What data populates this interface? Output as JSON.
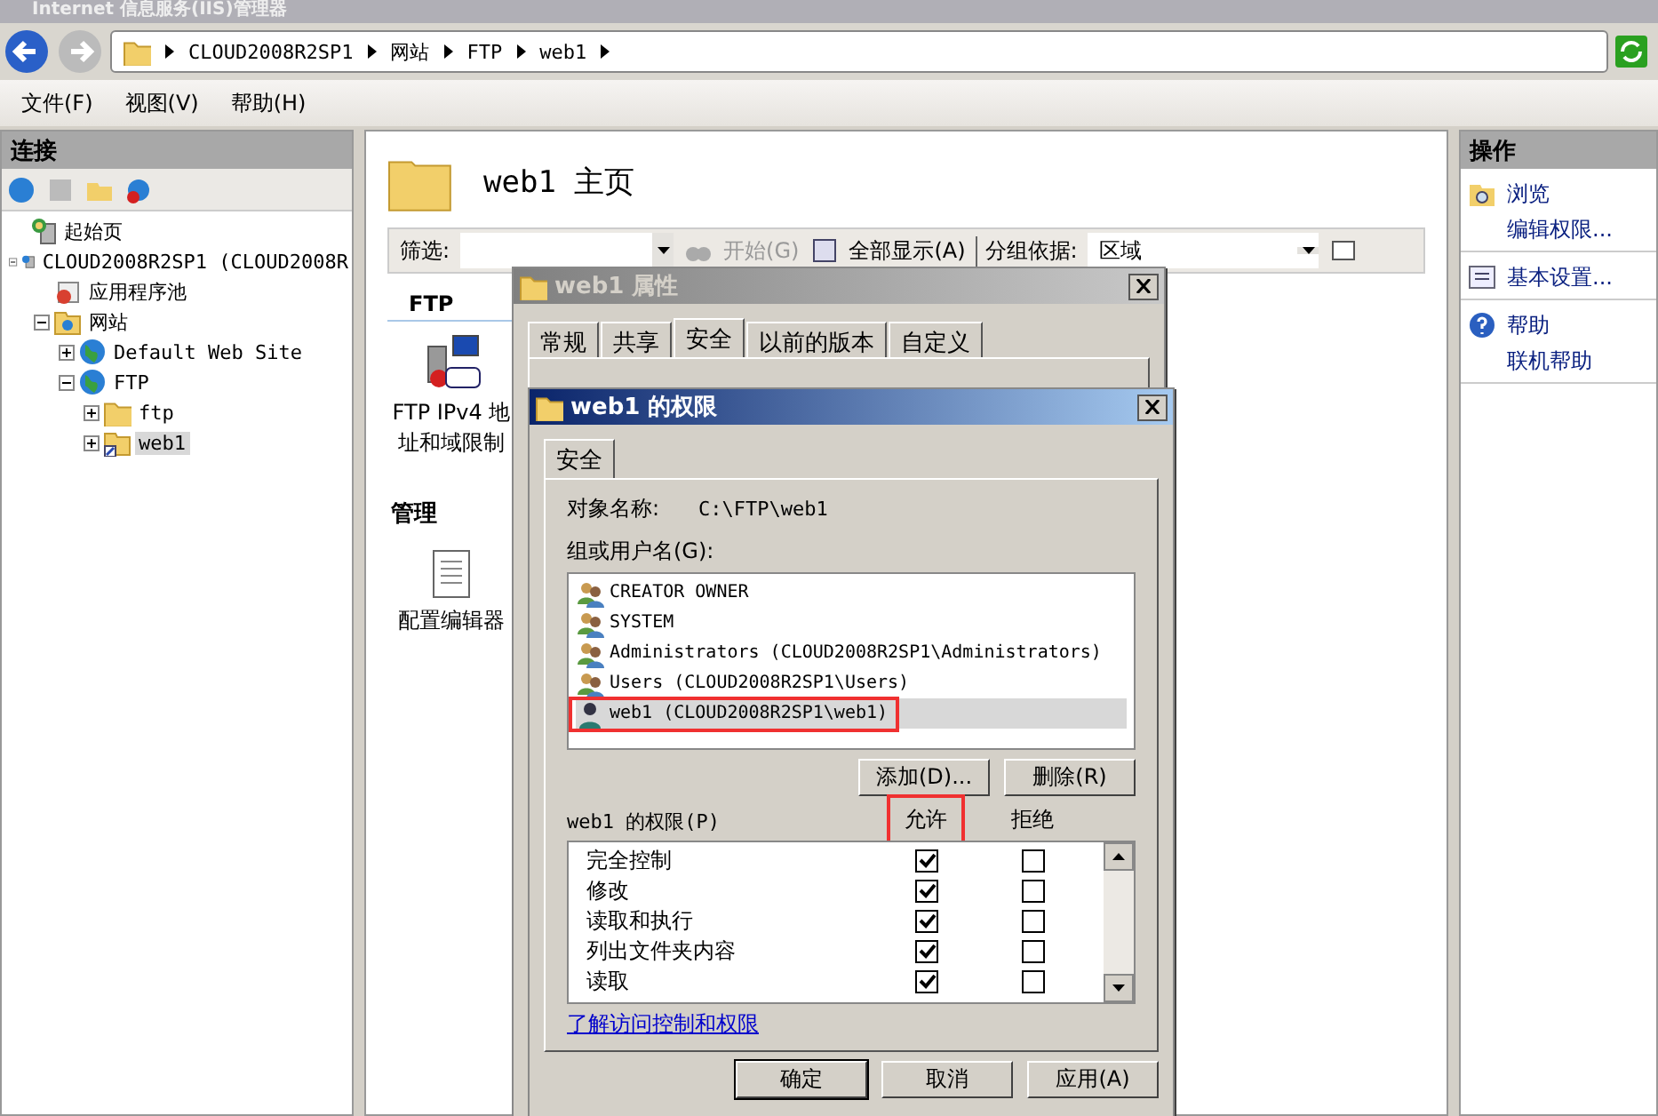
{
  "window": {
    "title": "Internet 信息服务(IIS)管理器"
  },
  "breadcrumb": [
    "CLOUD2008R2SP1",
    "网站",
    "FTP",
    "web1"
  ],
  "menu": [
    "文件(F)",
    "视图(V)",
    "帮助(H)"
  ],
  "connections": {
    "title": "连接",
    "tree": [
      {
        "label": "起始页",
        "kind": "start"
      },
      {
        "label": "CLOUD2008R2SP1 (CLOUD2008R",
        "kind": "server",
        "expanded": true,
        "children": [
          {
            "label": "应用程序池",
            "kind": "pool"
          },
          {
            "label": "网站",
            "kind": "sites",
            "expanded": true,
            "children": [
              {
                "label": "Default Web Site",
                "kind": "site",
                "expanded": false
              },
              {
                "label": "FTP",
                "kind": "site",
                "expanded": true,
                "children": [
                  {
                    "label": "ftp",
                    "kind": "folder",
                    "expanded": false,
                    "selected": false
                  },
                  {
                    "label": "web1",
                    "kind": "vdir",
                    "expanded": false,
                    "selected": true
                  }
                ]
              }
            ]
          }
        ]
      }
    ]
  },
  "content": {
    "title": "web1 主页",
    "filter": {
      "label": "筛选:",
      "go": {
        "label": "开始(G)",
        "disabled": true
      },
      "show_all": "全部显示(A)",
      "group_label": "分组依据:",
      "group_value": "区域"
    },
    "sections": [
      {
        "title": "FTP",
        "items": [
          {
            "label": "FTP IPv4 地址和域限制",
            "kind": "ftp"
          }
        ]
      },
      {
        "title": "管理",
        "items": [
          {
            "label": "配置编辑器",
            "kind": "config"
          }
        ]
      }
    ]
  },
  "actions": {
    "title": "操作",
    "groups": [
      {
        "items": [
          {
            "label": "浏览",
            "kind": "browse"
          },
          {
            "label": "编辑权限..."
          }
        ]
      },
      {
        "items": [
          {
            "label": "基本设置...",
            "kind": "settings"
          }
        ]
      },
      {
        "items": [
          {
            "label": "帮助",
            "kind": "help"
          },
          {
            "label": "联机帮助"
          }
        ]
      }
    ]
  },
  "properties_dialog": {
    "title": "web1 属性",
    "tabs": [
      {
        "label": "常规",
        "selected": false
      },
      {
        "label": "共享",
        "selected": false
      },
      {
        "label": "安全",
        "selected": true
      },
      {
        "label": "以前的版本",
        "selected": false
      },
      {
        "label": "自定义",
        "selected": false
      }
    ]
  },
  "permissions_dialog": {
    "title": "web1 的权限",
    "tab": "安全",
    "object_label": "对象名称:",
    "object_value": "C:\\FTP\\web1",
    "group_label": "组或用户名(G):",
    "users": [
      {
        "name": "CREATOR OWNER",
        "kind": "group",
        "selected": false,
        "highlighted": false
      },
      {
        "name": "SYSTEM",
        "kind": "group",
        "selected": false,
        "highlighted": false
      },
      {
        "name": "Administrators (CLOUD2008R2SP1\\Administrators)",
        "kind": "group",
        "selected": false,
        "highlighted": false
      },
      {
        "name": "Users (CLOUD2008R2SP1\\Users)",
        "kind": "group",
        "selected": false,
        "highlighted": false
      },
      {
        "name": "web1 (CLOUD2008R2SP1\\web1)",
        "kind": "user",
        "selected": true,
        "highlighted": true
      }
    ],
    "add_button": "添加(D)...",
    "remove_button": "删除(R)",
    "perm_label": "web1 的权限(P)",
    "allow_header": {
      "label": "允许",
      "highlighted": true
    },
    "deny_header": "拒绝",
    "permissions": [
      {
        "name": "完全控制",
        "allow": true,
        "deny": false
      },
      {
        "name": "修改",
        "allow": true,
        "deny": false
      },
      {
        "name": "读取和执行",
        "allow": true,
        "deny": false
      },
      {
        "name": "列出文件夹内容",
        "allow": true,
        "deny": false
      },
      {
        "name": "读取",
        "allow": true,
        "deny": false
      }
    ],
    "link": "了解访问控制和权限",
    "buttons": [
      "确定",
      "取消",
      "应用(A)"
    ]
  }
}
